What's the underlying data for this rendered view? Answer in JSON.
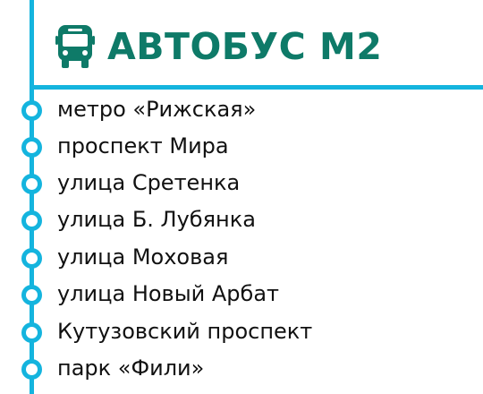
{
  "colors": {
    "line": "#14b4de",
    "title": "#0e7a68",
    "icon": "#0e7a68"
  },
  "header": {
    "icon": "bus-icon",
    "title": "АВТОБУС М2"
  },
  "stops": [
    {
      "label": "метро «Рижская»"
    },
    {
      "label": "проспект Мира"
    },
    {
      "label": "улица Сретенка"
    },
    {
      "label": "улица Б. Лубянка"
    },
    {
      "label": "улица Моховая"
    },
    {
      "label": "улица Новый Арбат"
    },
    {
      "label": "Кутузовский проспект"
    },
    {
      "label": "парк «Фили»"
    }
  ]
}
